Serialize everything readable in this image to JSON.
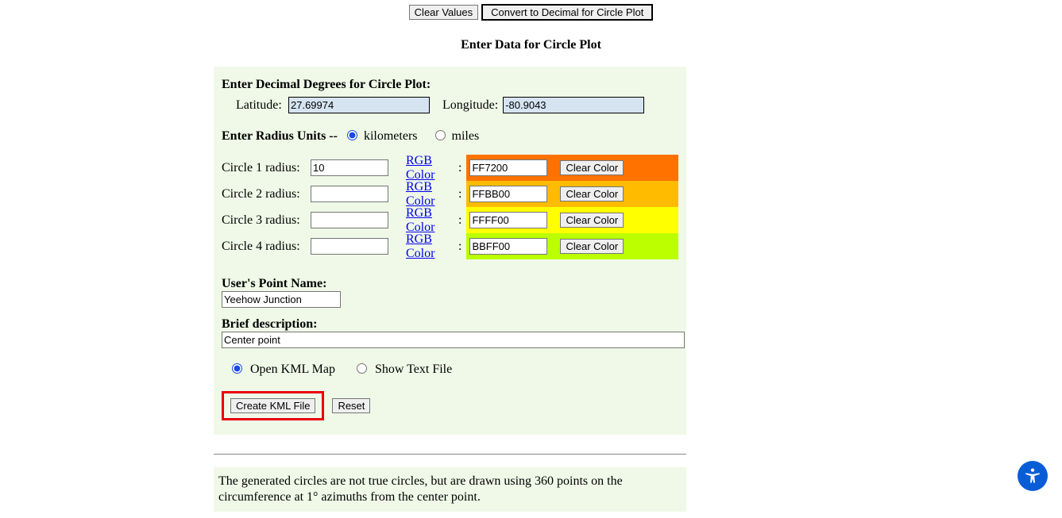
{
  "top": {
    "clear_values": "Clear Values",
    "convert": "Convert to Decimal for Circle Plot"
  },
  "section_title": "Enter Data for Circle Plot",
  "dd_heading": "Enter Decimal Degrees for Circle Plot:",
  "lat_label": "Latitude:",
  "lat_value": "27.69974",
  "lon_label": "Longitude:",
  "lon_value": "-80.9043",
  "units": {
    "prefix": "Enter Radius Units -- ",
    "km_label": "kilometers",
    "miles_label": "miles"
  },
  "rgb_link": "RGB Color",
  "clear_color": "Clear Color",
  "circles": [
    {
      "label": "Circle 1 radius:",
      "radius": "10",
      "color": "FF7200",
      "bg": "#FF7200"
    },
    {
      "label": "Circle 2 radius:",
      "radius": "",
      "color": "FFBB00",
      "bg": "#FFBB00"
    },
    {
      "label": "Circle 3 radius:",
      "radius": "",
      "color": "FFFF00",
      "bg": "#FFFF00"
    },
    {
      "label": "Circle 4 radius:",
      "radius": "",
      "color": "BBFF00",
      "bg": "#BBFF00"
    }
  ],
  "point_name_heading": "User's Point Name:",
  "point_name_value": "Yeehow Junction",
  "desc_heading": "Brief description:",
  "desc_value": "Center point",
  "out": {
    "open_kml": "Open KML Map",
    "show_text": "Show Text File"
  },
  "actions": {
    "create": "Create KML File",
    "reset": "Reset"
  },
  "note": "The generated circles are not true circles, but are drawn using 360 points on the circumference at 1° azimuths from the center point."
}
